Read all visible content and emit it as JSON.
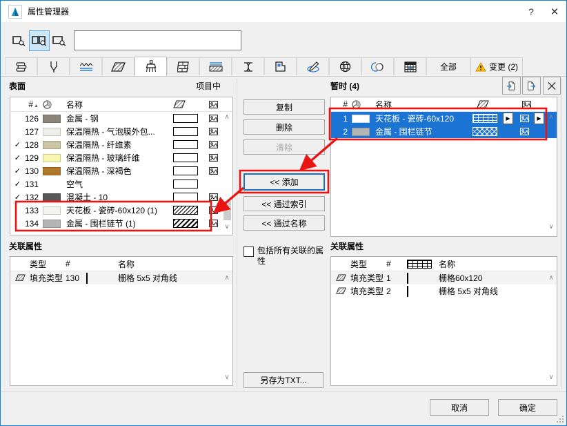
{
  "win": {
    "title": "属性管理器",
    "help": "?",
    "close": "✕"
  },
  "colors": {
    "accent": "#1581d5",
    "selection": "#1b74d3",
    "annotation_red": "#e81414",
    "warning_yellow": "#f5b800"
  },
  "toolbar": {
    "search_value": "",
    "search_placeholder": ""
  },
  "tabs": {
    "icons": [
      "layers",
      "pens",
      "line-types",
      "fill-types",
      "surfaces",
      "composites",
      "building-materials",
      "profiles",
      "zone-categories",
      "markup-styles",
      "cities",
      "renovation",
      "operation-profiles"
    ],
    "selected": "surfaces",
    "all_label": "全部",
    "changes_label": "变更 (2)"
  },
  "left": {
    "title": "表面",
    "scope": "项目中",
    "col_index": "#",
    "col_name": "名称",
    "rows": [
      {
        "check": "",
        "idx": "126",
        "swatch": "#8d8478",
        "name": "金属 - 钢",
        "fill": "empty",
        "texture": true
      },
      {
        "check": "",
        "idx": "127",
        "swatch": "#edf0eb",
        "name": "保温隔热 - 气泡膜外包...",
        "fill": "empty",
        "texture": true
      },
      {
        "check": "✓",
        "idx": "128",
        "swatch": "#cbc5a5",
        "name": "保温隔热 - 纤维素",
        "fill": "empty",
        "texture": true
      },
      {
        "check": "✓",
        "idx": "129",
        "swatch": "#f6f6ae",
        "name": "保温隔热 - 玻璃纤维",
        "fill": "empty",
        "texture": true
      },
      {
        "check": "✓",
        "idx": "130",
        "swatch": "#b0772a",
        "name": "保温隔热 - 深褐色",
        "fill": "empty",
        "texture": true
      },
      {
        "check": "✓",
        "idx": "131",
        "swatch": "",
        "name": "空气",
        "fill": "empty",
        "texture": false
      },
      {
        "check": "✓",
        "idx": "132",
        "swatch": "#575757",
        "name": "混凝土 - 10",
        "fill": "empty",
        "texture": true
      },
      {
        "check": "",
        "idx": "133",
        "swatch": "#f3f3ef",
        "name": "天花板 - 瓷砖-60x120 (1)",
        "fill": "diag",
        "texture": true
      },
      {
        "check": "",
        "idx": "134",
        "swatch": "#b4b4b4",
        "name": "金属 - 围栏链节 (1)",
        "fill": "diag-dense",
        "texture": true
      }
    ],
    "assoc": {
      "title": "关联属性",
      "col_type": "类型",
      "col_index": "#",
      "col_name": "名称",
      "rows": [
        {
          "type": "填充类型",
          "idx": "130",
          "pattern": "crosshatch",
          "name": "栅格 5x5 对角线"
        }
      ]
    }
  },
  "mid": {
    "copy": "复制",
    "delete": "删除",
    "purge": "清除",
    "add": "<< 添加",
    "by_index": "<< 通过索引",
    "by_name": "<< 通过名称",
    "include_assoc": "包括所有关联的属性",
    "save_txt": "另存为TXT..."
  },
  "right": {
    "title": "暂时 (4)",
    "col_index": "#",
    "col_name": "名称",
    "rows": [
      {
        "idx": "1",
        "swatch": "#ffffff",
        "name": "天花板 - 瓷砖-60x120",
        "pattern": "grid",
        "selected": true
      },
      {
        "idx": "2",
        "swatch": "#b4b4b4",
        "name": "金属 - 围栏链节",
        "pattern": "crosshatch",
        "selected": true
      }
    ],
    "assoc": {
      "title": "关联属性",
      "col_type": "类型",
      "col_index": "#",
      "col_name": "名称",
      "rows": [
        {
          "type": "填充类型",
          "idx": "1",
          "pattern": "grid",
          "name": "栅格60x120"
        },
        {
          "type": "填充类型",
          "idx": "2",
          "pattern": "crosshatch",
          "name": "栅格 5x5 对角线"
        }
      ]
    }
  },
  "foot": {
    "cancel": "取消",
    "ok": "确定"
  }
}
